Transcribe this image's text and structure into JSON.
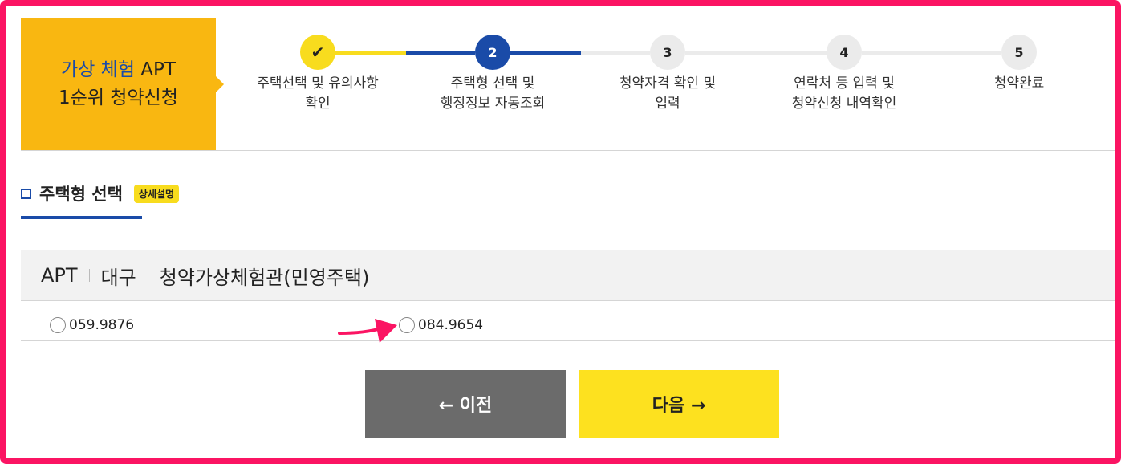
{
  "title_box": {
    "line1_blue": "가상 체험",
    "line1_rest": "APT",
    "line2": "1순위 청약신청"
  },
  "steps": [
    {
      "number": "✔",
      "state": "done",
      "label_line1": "주택선택 및 유의사항",
      "label_line2": "확인"
    },
    {
      "number": "2",
      "state": "active",
      "label_line1": "주택형 선택 및",
      "label_line2": "행정정보 자동조회"
    },
    {
      "number": "3",
      "state": "todo",
      "label_line1": "청약자격 확인 및",
      "label_line2": "입력"
    },
    {
      "number": "4",
      "state": "todo",
      "label_line1": "연락처 등 입력 및",
      "label_line2": "청약신청 내역확인"
    },
    {
      "number": "5",
      "state": "todo",
      "label_line1": "청약완료",
      "label_line2": ""
    }
  ],
  "section": {
    "title": "주택형 선택",
    "badge": "상세설명"
  },
  "info": {
    "type": "APT",
    "region": "대구",
    "name": "청약가상체험관(민영주택)"
  },
  "options": [
    {
      "value": "059.9876",
      "selected": false
    },
    {
      "value": "084.9654",
      "selected": false
    }
  ],
  "buttons": {
    "prev": "← 이전",
    "next": "다음 →"
  },
  "colors": {
    "frame": "#fb1463",
    "accent_yellow": "#f8dc1e",
    "title_yellow": "#f9b711",
    "accent_blue": "#1a4ba8",
    "prev_gray": "#6b6b6b"
  }
}
